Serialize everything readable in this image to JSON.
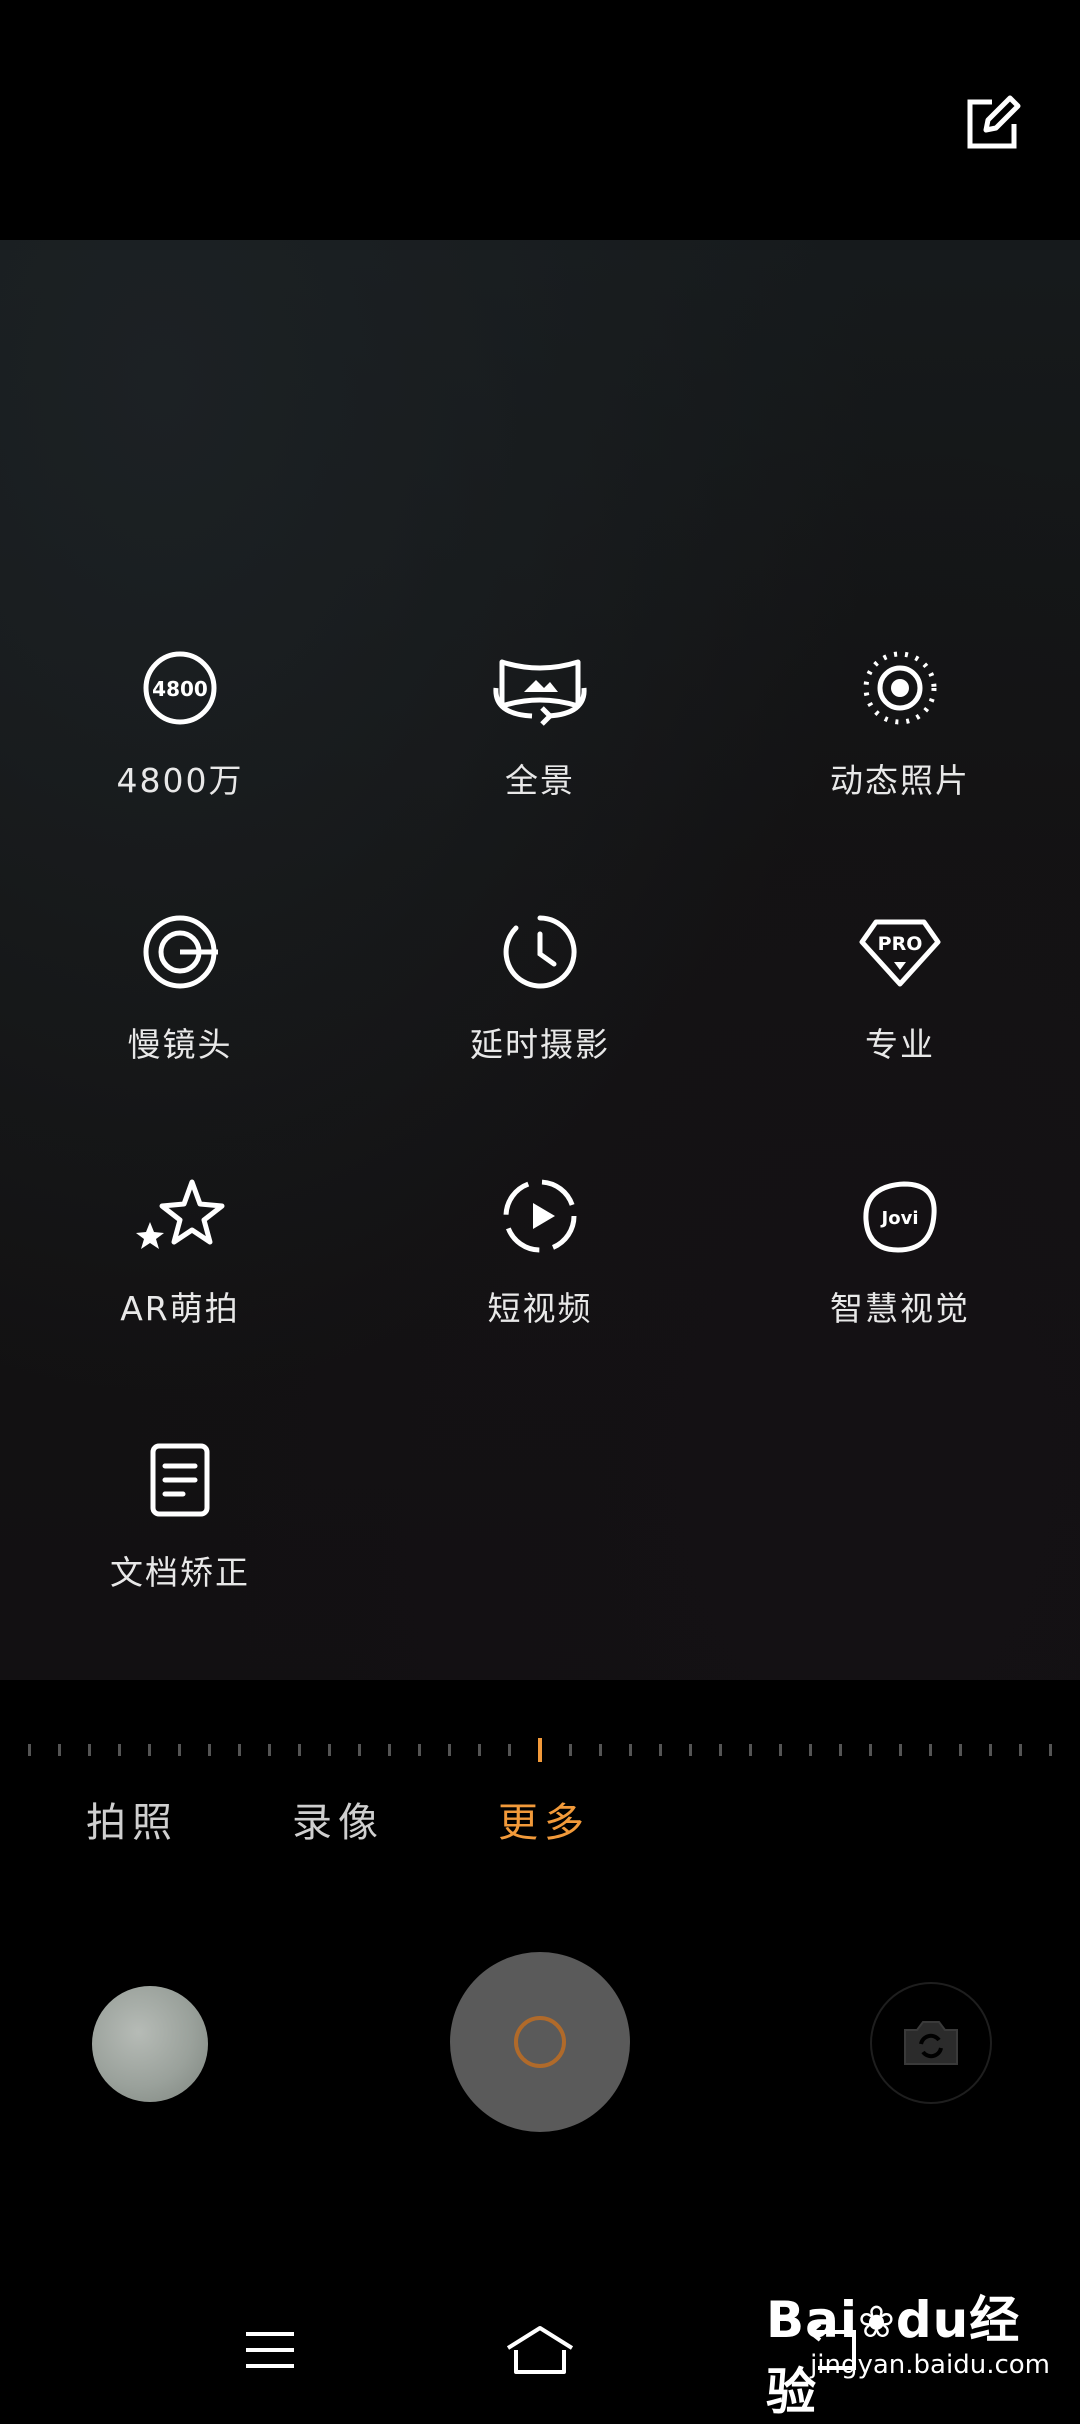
{
  "modes": [
    {
      "label": "4800万",
      "icon": "4800-icon",
      "badge": "4800"
    },
    {
      "label": "全景",
      "icon": "panorama-icon"
    },
    {
      "label": "动态照片",
      "icon": "live-photo-icon"
    },
    {
      "label": "慢镜头",
      "icon": "slow-motion-icon"
    },
    {
      "label": "延时摄影",
      "icon": "time-lapse-icon"
    },
    {
      "label": "专业",
      "icon": "pro-icon",
      "badge": "PRO"
    },
    {
      "label": "AR萌拍",
      "icon": "ar-stars-icon"
    },
    {
      "label": "短视频",
      "icon": "short-video-icon"
    },
    {
      "label": "智慧视觉",
      "icon": "jovi-icon",
      "badge": "Jovi"
    },
    {
      "label": "文档矫正",
      "icon": "document-icon"
    }
  ],
  "tabs": {
    "photo": "拍照",
    "video": "录像",
    "more": "更多",
    "active": "more"
  },
  "colors": {
    "accent": "#f29a3a",
    "background": "#000000"
  },
  "watermark": {
    "logo_bai": "Bai",
    "logo_du": "du",
    "logo_jingyan": "经验",
    "url": "jingyan.baidu.com"
  }
}
